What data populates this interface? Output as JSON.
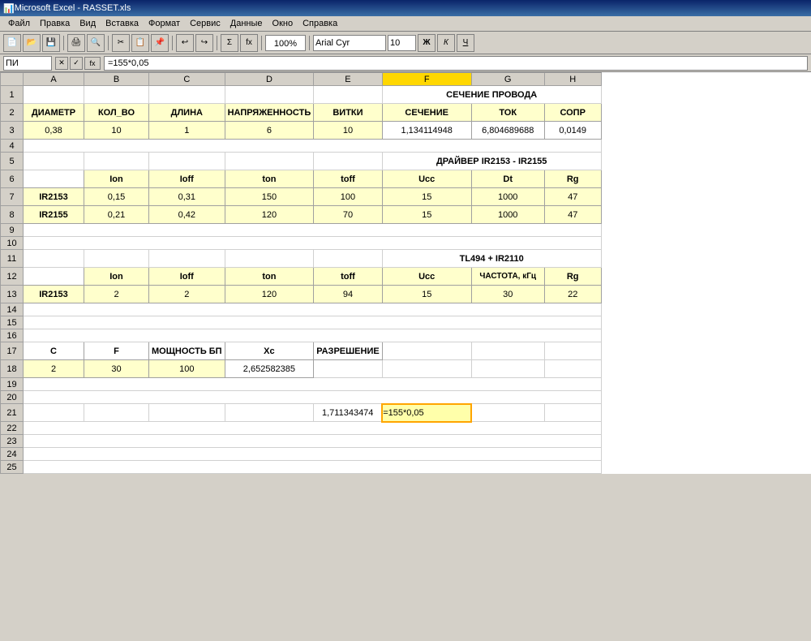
{
  "window": {
    "title": "Microsoft Excel - RASSET.xls",
    "icon": "📊"
  },
  "menu": {
    "items": [
      "Файл",
      "Правка",
      "Вид",
      "Вставка",
      "Формат",
      "Сервис",
      "Данные",
      "Окно",
      "Справка"
    ]
  },
  "formula_bar": {
    "name_box": "ПИ",
    "formula": "=155*0,05"
  },
  "toolbar": {
    "zoom": "100%",
    "font": "Arial Cyr",
    "font_size": "10"
  },
  "columns": {
    "headers": [
      "A",
      "B",
      "C",
      "D",
      "E",
      "F",
      "G",
      "H"
    ],
    "widths": [
      75,
      80,
      80,
      100,
      80,
      100,
      90,
      75
    ]
  },
  "rows": {
    "data": [
      {
        "row": 1,
        "cells": [
          {
            "col": "A",
            "val": "",
            "style": "normal"
          },
          {
            "col": "B",
            "val": "",
            "style": "normal"
          },
          {
            "col": "C",
            "val": "",
            "style": "normal"
          },
          {
            "col": "D",
            "val": "",
            "style": "normal"
          },
          {
            "col": "E",
            "val": "",
            "style": "normal"
          },
          {
            "col": "F",
            "val": "СЕЧЕНИЕ ПРОВОДА",
            "style": "title",
            "colspan": 3
          }
        ]
      }
    ]
  },
  "sheet": {
    "row1": {
      "merged": "СЕЧЕНИЕ ПРОВОДА"
    },
    "row2_headers": [
      "ДИАМЕТР",
      "КОЛ_ВО",
      "ДЛИНА",
      "НАПРЯЖЕННОСТЬ",
      "ВИТКИ",
      "СЕЧЕНИЕ",
      "ТОК",
      "СОПР"
    ],
    "row3_data": [
      "0,38",
      "10",
      "1",
      "6",
      "10",
      "1,134114948",
      "6,804689688",
      "0,0149"
    ],
    "row5_merged": "ДРАЙВЕР IR2153 - IR2155",
    "row6_headers": [
      "",
      "Ion",
      "Ioff",
      "ton",
      "toff",
      "Ucc",
      "Dt",
      "Rg"
    ],
    "row7_ir2153": [
      "IR2153",
      "0,15",
      "0,31",
      "150",
      "100",
      "15",
      "1000",
      "47"
    ],
    "row8_ir2155": [
      "IR2155",
      "0,21",
      "0,42",
      "120",
      "70",
      "15",
      "1000",
      "47"
    ],
    "row11_merged": "TL494 + IR2110",
    "row12_headers": [
      "",
      "Ion",
      "Ioff",
      "ton",
      "toff",
      "Ucc",
      "ЧАСТОТА, кГц",
      "Rg"
    ],
    "row13_ir2153": [
      "IR2153",
      "2",
      "2",
      "120",
      "94",
      "15",
      "30",
      "22"
    ],
    "row17_labels": [
      "C",
      "F",
      "МОЩНОСТЬ БП",
      "Xc",
      "РАЗРЕШЕНИЕ",
      "",
      "",
      ""
    ],
    "row18_vals": [
      "2",
      "30",
      "100",
      "2,652582385",
      "",
      "",
      "",
      ""
    ],
    "row21_vals": [
      "",
      "",
      "",
      "",
      "1,711343474",
      "=155*0,05",
      "",
      ""
    ]
  }
}
